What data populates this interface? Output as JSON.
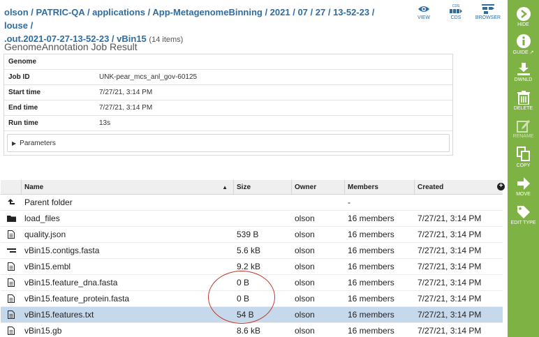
{
  "breadcrumb": {
    "segments": [
      "olson",
      "PATRIC-QA",
      "applications",
      "App-MetagenomeBinning",
      "2021",
      "07",
      "27",
      "13-52-23",
      "louse",
      ".out.2021-07-27-13-52-23",
      "vBin15"
    ],
    "item_count": "(14 items)"
  },
  "view_toggles": [
    {
      "label": "VIEW",
      "icon": "eye-icon"
    },
    {
      "label": "CDS",
      "icon": "cds-icon",
      "caption": "CDS"
    },
    {
      "label": "BROWSER",
      "icon": "browser-icon"
    }
  ],
  "job": {
    "title": "GenomeAnnotation Job Result",
    "rows": [
      {
        "key": "Genome",
        "value": ""
      },
      {
        "key": "Job ID",
        "value": "UNK-pear_mcs_anl_gov-60125"
      },
      {
        "key": "Start time",
        "value": "7/27/21, 3:14 PM"
      },
      {
        "key": "End time",
        "value": "7/27/21, 3:14 PM"
      },
      {
        "key": "Run time",
        "value": "13s"
      }
    ],
    "parameters_label": "Parameters"
  },
  "grid": {
    "columns": {
      "name": "Name",
      "size": "Size",
      "owner": "Owner",
      "members": "Members",
      "created": "Created"
    },
    "rows": [
      {
        "icon": "parent-folder-icon",
        "name": "Parent folder",
        "size": "",
        "owner": "",
        "members": "-",
        "created": ""
      },
      {
        "icon": "folder-icon",
        "name": "load_files",
        "size": "",
        "owner": "olson",
        "members": "16 members",
        "created": "7/27/21, 3:14 PM"
      },
      {
        "icon": "file-icon",
        "name": "quality.json",
        "size": "539 B",
        "owner": "olson",
        "members": "16 members",
        "created": "7/27/21, 3:14 PM"
      },
      {
        "icon": "contigs-icon",
        "name": "vBin15.contigs.fasta",
        "size": "5.6 kB",
        "owner": "olson",
        "members": "16 members",
        "created": "7/27/21, 3:14 PM"
      },
      {
        "icon": "file-icon",
        "name": "vBin15.embl",
        "size": "9.2 kB",
        "owner": "olson",
        "members": "16 members",
        "created": "7/27/21, 3:14 PM"
      },
      {
        "icon": "file-icon",
        "name": "vBin15.feature_dna.fasta",
        "size": "0 B",
        "owner": "olson",
        "members": "16 members",
        "created": "7/27/21, 3:14 PM"
      },
      {
        "icon": "file-icon",
        "name": "vBin15.feature_protein.fasta",
        "size": "0 B",
        "owner": "olson",
        "members": "16 members",
        "created": "7/27/21, 3:14 PM"
      },
      {
        "icon": "file-icon",
        "name": "vBin15.features.txt",
        "size": "54 B",
        "owner": "olson",
        "members": "16 members",
        "created": "7/27/21, 3:14 PM",
        "selected": true
      },
      {
        "icon": "file-icon",
        "name": "vBin15.gb",
        "size": "8.6 kB",
        "owner": "olson",
        "members": "16 members",
        "created": "7/27/21, 3:14 PM"
      }
    ]
  },
  "actions": [
    {
      "label": "HIDE",
      "icon": "arrow-right-circle-icon"
    },
    {
      "label": "GUIDE",
      "icon": "info-icon"
    },
    {
      "label": "DWNLD",
      "icon": "download-icon"
    },
    {
      "label": "DELETE",
      "icon": "trash-icon"
    },
    {
      "label": "RENAME",
      "icon": "pencil-icon",
      "disabled": true
    },
    {
      "label": "COPY",
      "icon": "copy-icon"
    },
    {
      "label": "MOVE",
      "icon": "arrow-right-icon"
    },
    {
      "label": "EDIT TYPE",
      "icon": "tag-icon"
    }
  ],
  "colors": {
    "link": "#2e6da4",
    "actionbar": "#7fb245",
    "selected_row": "#c6d9ec",
    "annotation": "#c0392b"
  }
}
